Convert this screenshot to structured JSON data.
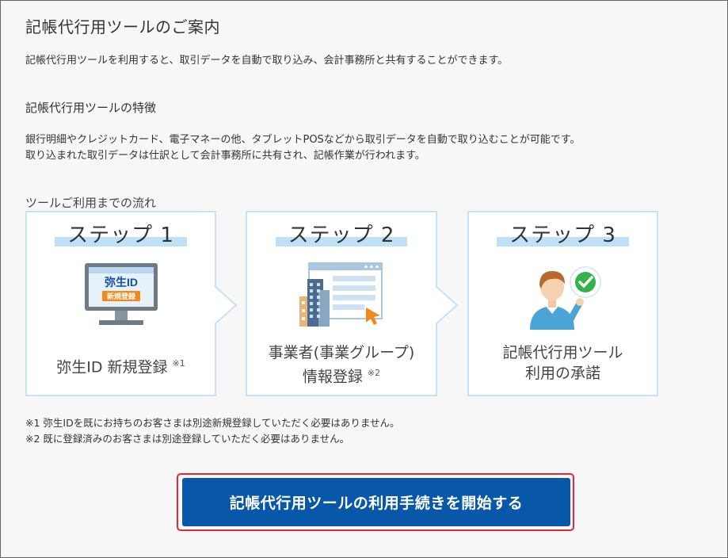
{
  "page": {
    "title": "記帳代行用ツールのご案内",
    "intro": "記帳代行用ツールを利用すると、取引データを自動で取り込み、会計事務所と共有することができます。",
    "features_heading": "記帳代行用ツールの特徴",
    "features_lines": [
      "銀行明細やクレジットカード、電子マネーの他、タブレットPOSなどから取引データを自動で取り込むことが可能です。",
      "取り込まれた取引データは仕訳として会計事務所に共有され、記帳作業が行われます。"
    ],
    "flow_label": "ツールご利用までの流れ"
  },
  "steps": [
    {
      "title": "ステップ 1",
      "label_lines": [
        "弥生ID 新規登録"
      ],
      "note": "※1",
      "icon": "monitor-yayoi-id-icon",
      "icon_text_main": "弥生ID",
      "icon_text_badge": "新規登録"
    },
    {
      "title": "ステップ 2",
      "label_lines": [
        "事業者(事業グループ)",
        "情報登録"
      ],
      "note": "※2",
      "icon": "building-window-icon"
    },
    {
      "title": "ステップ 3",
      "label_lines": [
        "記帳代行用ツール",
        "利用の承諾"
      ],
      "note": "",
      "icon": "person-check-icon"
    }
  ],
  "footnotes": [
    "※1  弥生IDを既にお持ちのお客さまは別途新規登録していただく必要はありません。",
    "※2  既に登録済みのお客さまは別途登録していただく必要はありません。"
  ],
  "cta": {
    "label": "記帳代行用ツールの利用手続きを開始する"
  },
  "colors": {
    "accent_blue": "#0857a8",
    "card_border": "#c6e3f6",
    "highlight": "#bfe1f6",
    "cta_outline": "#e5263a",
    "badge_orange": "#f08a1c",
    "check_green": "#33b24a"
  }
}
